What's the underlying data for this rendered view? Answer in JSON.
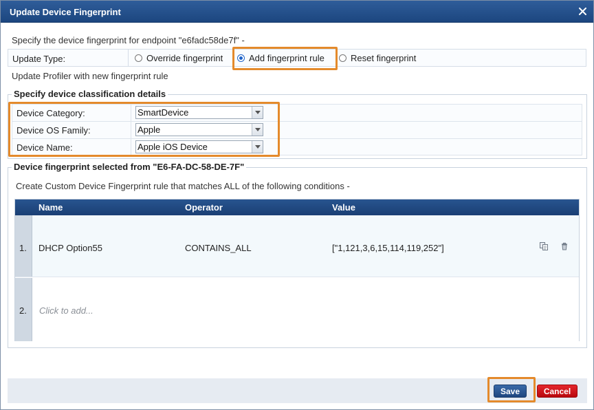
{
  "dialog": {
    "title": "Update Device Fingerprint",
    "subtitle": "Specify the device fingerprint for endpoint \"e6fadc58de7f\" -"
  },
  "update_type": {
    "label": "Update Type:",
    "options": [
      {
        "label": "Override fingerprint",
        "checked": false
      },
      {
        "label": "Add fingerprint rule",
        "checked": true
      },
      {
        "label": "Reset fingerprint",
        "checked": false
      }
    ]
  },
  "profiler_note": "Update Profiler with new fingerprint rule",
  "classification": {
    "legend": "Specify device classification details",
    "fields": [
      {
        "label": "Device Category:",
        "value": "SmartDevice"
      },
      {
        "label": "Device OS Family:",
        "value": "Apple"
      },
      {
        "label": "Device Name:",
        "value": "Apple iOS Device"
      }
    ]
  },
  "fingerprint": {
    "legend": "Device fingerprint selected from \"E6-FA-DC-58-DE-7F\"",
    "note": "Create Custom Device Fingerprint rule that matches ALL of the following conditions -",
    "columns": [
      "Name",
      "Operator",
      "Value"
    ],
    "rows": [
      {
        "num": "1.",
        "name": "DHCP Option55",
        "operator": "CONTAINS_ALL",
        "value": "[\"1,121,3,6,15,114,119,252\"]"
      }
    ],
    "add_row": {
      "num": "2.",
      "placeholder": "Click to add..."
    }
  },
  "buttons": {
    "save": "Save",
    "cancel": "Cancel"
  },
  "colors": {
    "highlight": "#e48a2b",
    "titlebar": "#1c467f",
    "save": "#1f4780",
    "cancel": "#c0111a"
  }
}
